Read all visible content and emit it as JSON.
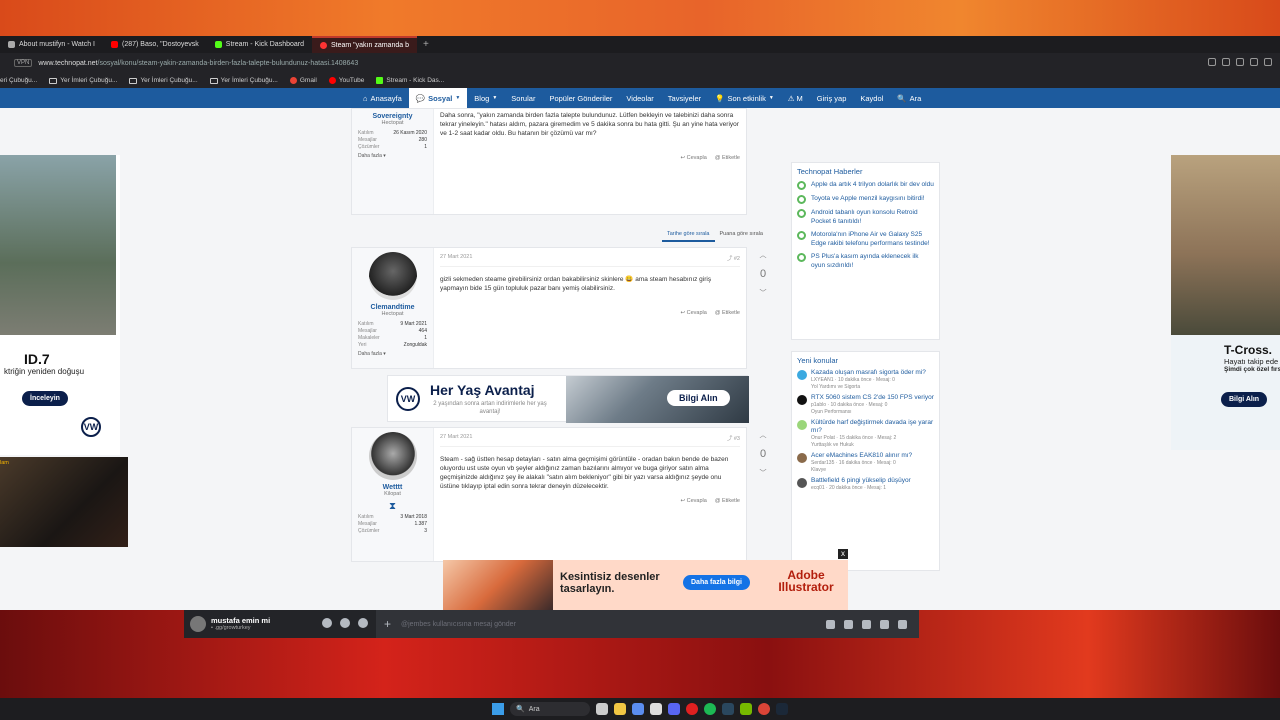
{
  "browser": {
    "tabs": [
      {
        "label": "About mustifyn - Watch I",
        "icon_color": "#aaaaaa"
      },
      {
        "label": "(287) Baso, \"Dostoyevsk",
        "icon_color": "#ff0000"
      },
      {
        "label": "Stream - Kick Dashboard",
        "icon_color": "#53fc18"
      },
      {
        "label": "Steam \"yakın zamanda b",
        "icon_color": "#ff3333",
        "active": true
      }
    ],
    "new_tab": "+",
    "vpn_label": "VPN",
    "url_domain": "www.technopat.net",
    "url_path": "/sosyal/konu/steam-yakin-zamanda-birden-fazla-talepte-bulundunuz-hatasi.1408643",
    "bookmarks": [
      {
        "label": "eri Çubuğu...",
        "type": "folder"
      },
      {
        "label": "Yer İmleri Çubuğu...",
        "type": "folder"
      },
      {
        "label": "Yer İmleri Çubuğu...",
        "type": "folder"
      },
      {
        "label": "Yer İmleri Çubuğu...",
        "type": "folder"
      },
      {
        "label": "Gmail",
        "type": "gmail"
      },
      {
        "label": "YouTube",
        "type": "youtube"
      },
      {
        "label": "Stream - Kick Das...",
        "type": "kick"
      }
    ]
  },
  "nav": {
    "items": [
      "Anasayfa",
      "Sosyal",
      "Blog",
      "Sorular",
      "Popüler Gönderiler",
      "Videolar",
      "Tavsiyeler",
      "Son etkinlik",
      "M"
    ],
    "login": "Giriş yap",
    "register": "Kaydol",
    "search": "Ara"
  },
  "post1": {
    "username": "Sovereignty",
    "role": "Hectopat",
    "stats": [
      {
        "k": "Katılım",
        "v": "26 Kasım 2020"
      },
      {
        "k": "Mesajlar",
        "v": "280"
      },
      {
        "k": "Çözümler",
        "v": "1"
      }
    ],
    "more": "Daha fazla ▾",
    "text": "Daha sonra, \"yakın zamanda birden fazla talepte bulundunuz. Lütfen bekleyin ve talebinizi daha sonra tekrar yineleyin.\" hatası aldım, pazara giremedim ve 5 dakika sonra bu hata gitti. Şu an yine hata veriyor ve 1-2 saat kadar oldu. Bu hatanın bir çözümü var mı?",
    "reply": "Cevapla",
    "tag": "Etiketle"
  },
  "sort": {
    "by_date": "Tarihe göre sırala",
    "by_score": "Puana göre sırala"
  },
  "post2": {
    "username": "Clemandtime",
    "role": "Hectopat",
    "stats": [
      {
        "k": "Katılım",
        "v": "9 Mart 2021"
      },
      {
        "k": "Mesajlar",
        "v": "464"
      },
      {
        "k": "Makaleler",
        "v": "1"
      },
      {
        "k": "Yeri",
        "v": "Zonguldak"
      }
    ],
    "more": "Daha fazla ▾",
    "date": "27 Mart 2021",
    "num": "#2",
    "text": "gizli sekmeden steame girebilirsiniz ordan bakabilirsiniz skinlere 😀 ama steam hesabınız giriş yapmayın bide 15 gün topluluk pazar banı yemiş olabilirsiniz.",
    "score": "0",
    "reply": "Cevapla",
    "tag": "Etiketle"
  },
  "post3": {
    "username": "Wetttt",
    "role": "Kilopat",
    "stats": [
      {
        "k": "Katılım",
        "v": "3 Mart 2018"
      },
      {
        "k": "Mesajlar",
        "v": "1.387"
      },
      {
        "k": "Çözümler",
        "v": "3"
      }
    ],
    "date": "27 Mart 2021",
    "num": "#3",
    "text": "Steam - sağ üstten hesap detayları - satın alma geçmişimi görüntüle - oradan bakın bende de bazen oluyordu ust uste oyun vb şeyler aldığınız zaman bazılarını almıyor ve buga giriyor satın alma geçmişinizde aldığınız şey ile alakalı \"satın alım bekleniyor\" gibi bir yazı varsa aldığınız şeyde onu üstüne tıklayıp iptal edin sonra tekrar deneyin düzelecektir.",
    "score": "0",
    "reply": "Cevapla",
    "tag": "Etiketle"
  },
  "news": {
    "title": "Technopat Haberler",
    "items": [
      "Apple da artık 4 trilyon dolarlık bir dev oldu",
      "Toyota ve Apple menzil kaygısını bitirdi!",
      "Android tabanlı oyun konsolu Retroid Pocket 6 tanıtıldı!",
      "Motorola'nın iPhone Air ve Galaxy S25 Edge rakibi telefonu performans testinde!",
      "PS Plus'a kasım ayında eklenecek ilk oyun sızdırıldı!"
    ]
  },
  "threads": {
    "title": "Yeni konular",
    "items": [
      {
        "title": "Kazada oluşan masrafı sigorta öder mi?",
        "meta": "LXYEAN1 · 10 dakika önce · Mesaj: 0",
        "forum": "Yol Yardımı ve Sigorta",
        "color": "#3ba9e0"
      },
      {
        "title": "RTX 5060 sistem CS 2'de 150 FPS veriyor",
        "meta": "p1ablo · 10 dakika önce · Mesaj: 0",
        "forum": "Oyun Performansı",
        "color": "#111111"
      },
      {
        "title": "Kültürde harf değiştirmek davada işe yarar mı?",
        "meta": "Onur Polat · 15 dakika önce · Mesaj: 2",
        "forum": "Yurttaşlık ve Hukuk",
        "color": "#9bd67a"
      },
      {
        "title": "Acer eMachines EAK810 alınır mı?",
        "meta": "Serdar135 · 16 dakika önce · Mesaj: 0",
        "forum": "Klavye",
        "color": "#8a6a4a"
      },
      {
        "title": "Battlefield 6 pingi yükselip düşüyor",
        "meta": "ecq01 · 20 dakika önce · Mesaj: 1",
        "forum": "",
        "color": "#555555"
      }
    ]
  },
  "ads": {
    "left_title": "ID.7",
    "left_sub": "ktriğin yeniden doğuşu",
    "left_btn": "İnceleyin",
    "brand_mark": "VW",
    "video_label": "lam",
    "right_title": "T-Cross.",
    "right_sub": "Hayatı takip ede",
    "right_sub2": "Şimdi çok özel fırsatl",
    "right_btn": "Bilgi Alın",
    "mid_title": "Her Yaş Avantaj",
    "mid_sub": "2 yaşından sonra artan indirimlerle her yaş avantaj!",
    "mid_btn": "Bilgi Alın",
    "bottom_title": "Kesintisiz desenler tasarlayın.",
    "bottom_btn": "Daha fazla bilgi",
    "bottom_brand": "Adobe Illustrator",
    "close": "x"
  },
  "discord": {
    "username": "mustafa emin mi",
    "status": "• .gg/growturkey",
    "placeholder": "@jembes kullanıcısına mesaj gönder",
    "plus": "+"
  },
  "taskbar": {
    "search": "Ara"
  }
}
